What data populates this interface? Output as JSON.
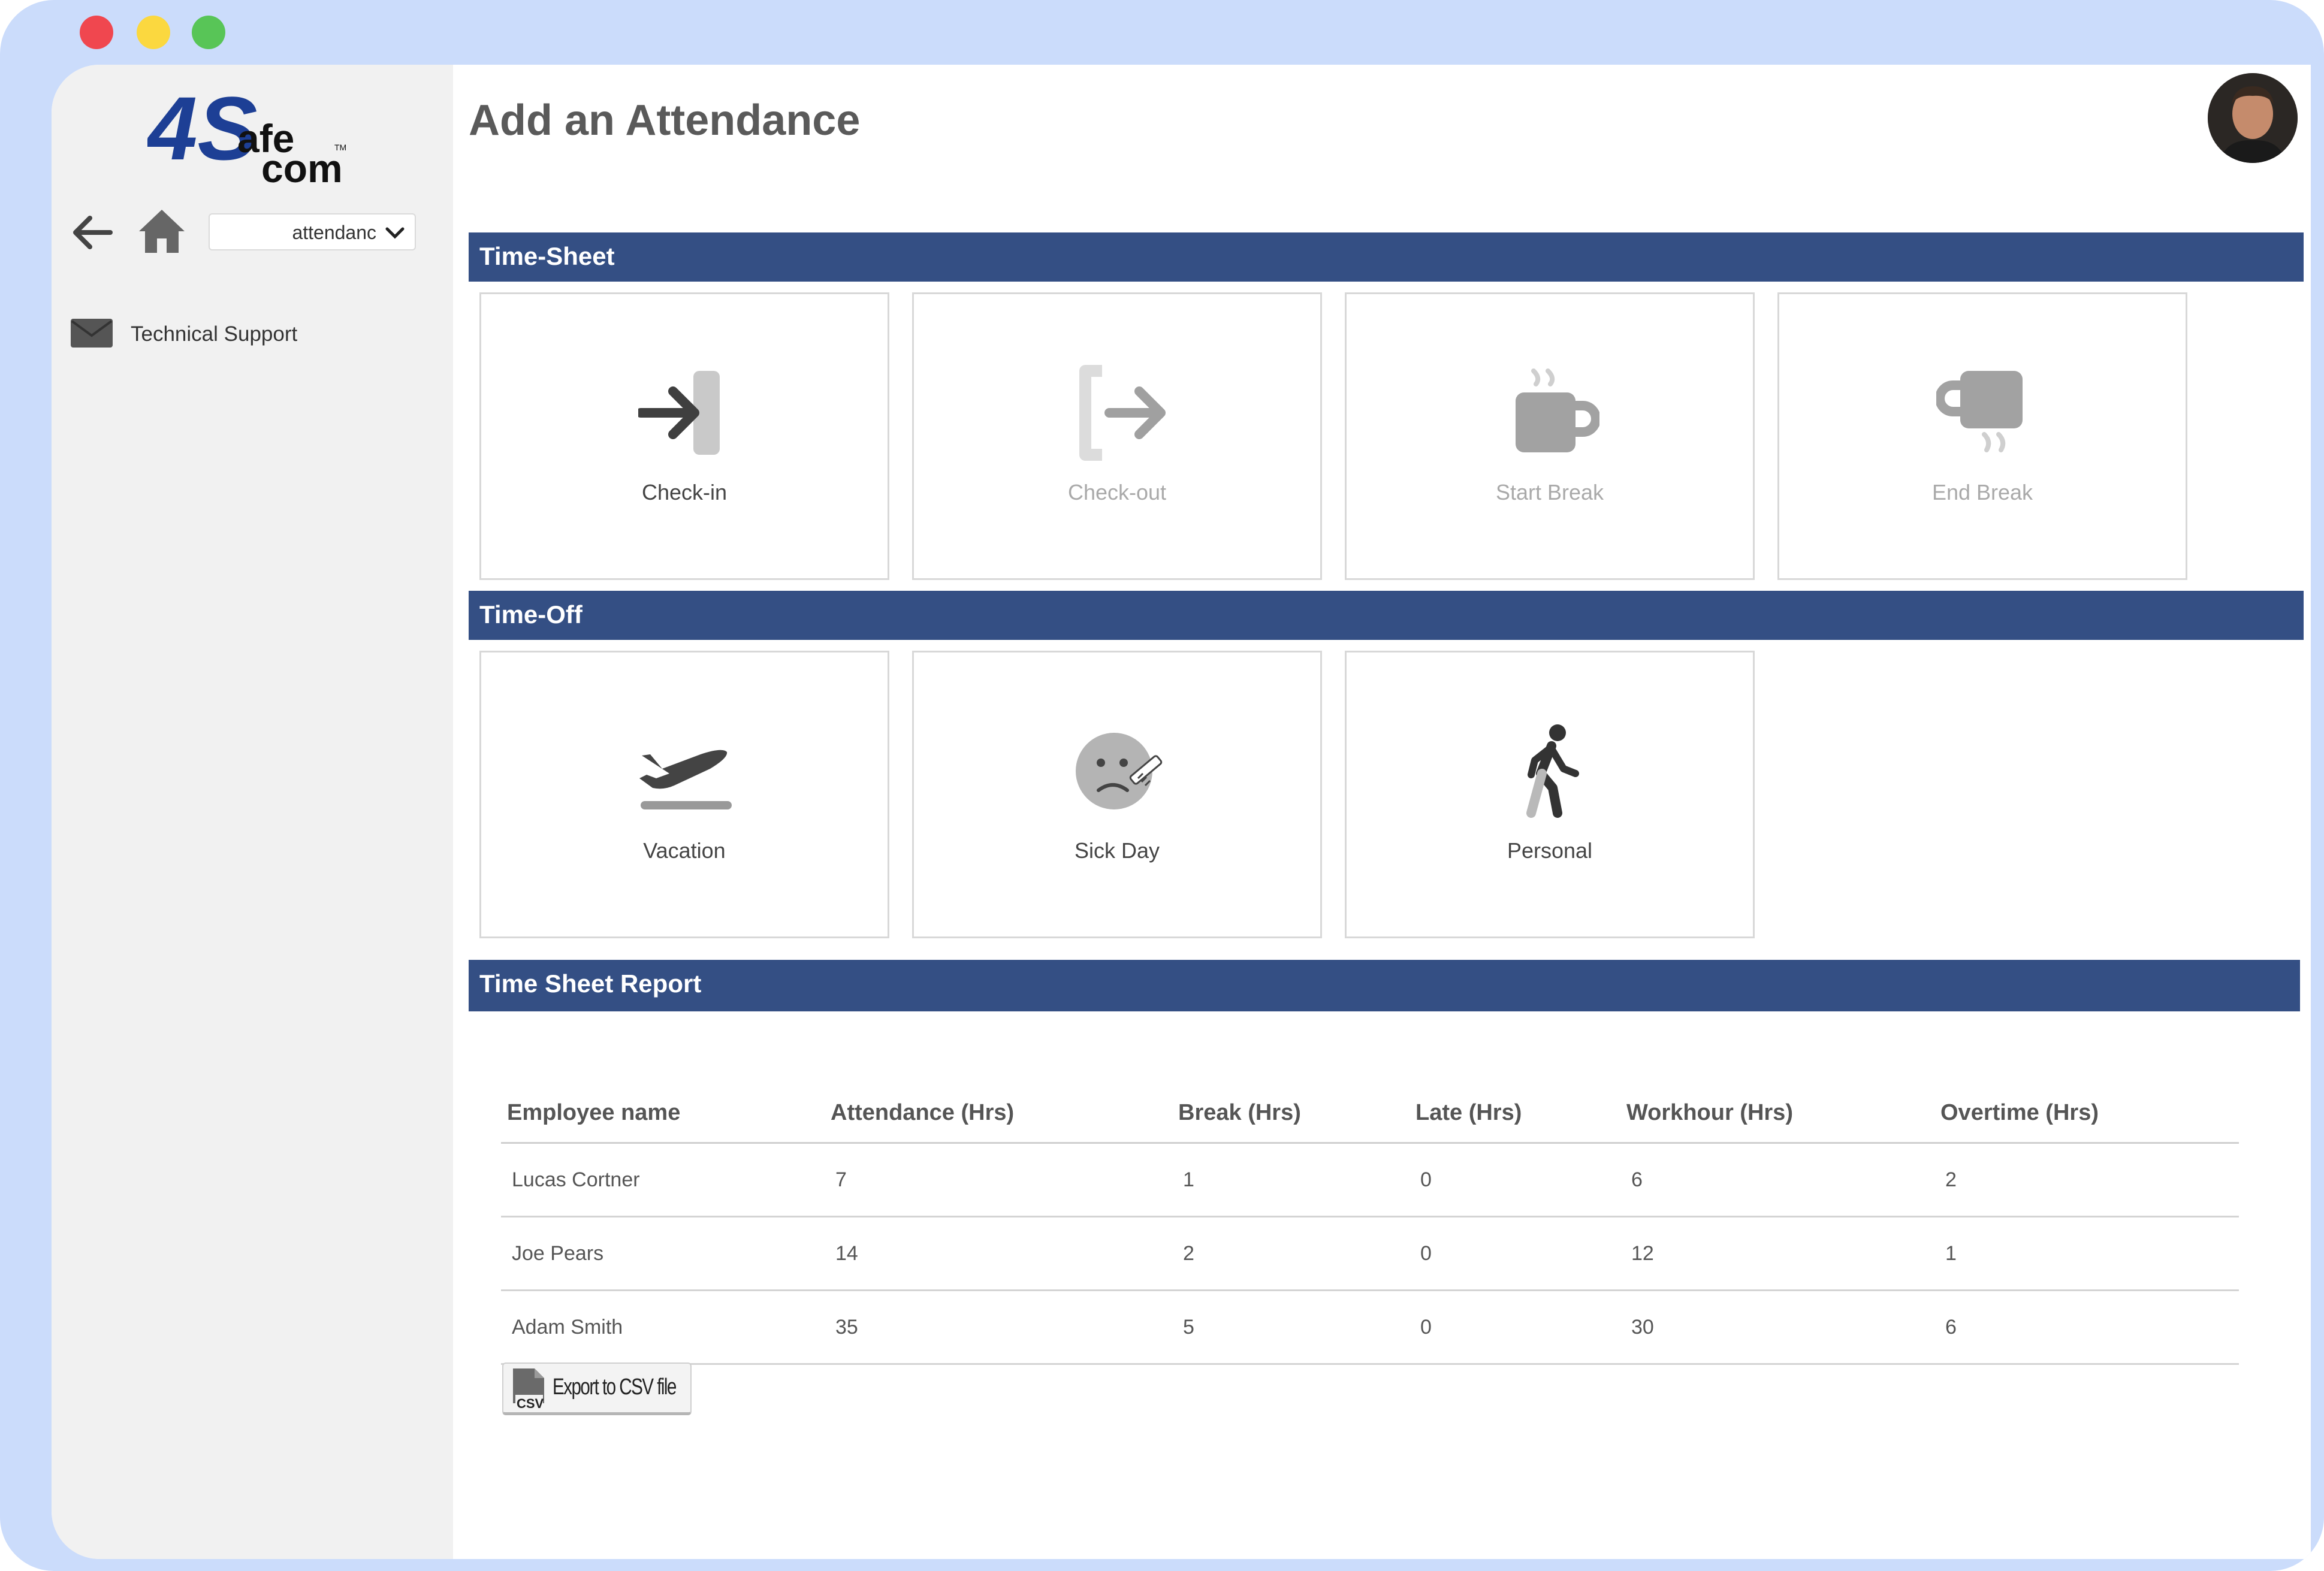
{
  "window": {
    "controls": [
      "close",
      "minimize",
      "maximize"
    ],
    "colors": {
      "frame": "#cbdcfb",
      "section_bar": "#344f84",
      "sidebar": "#f1f1f1"
    }
  },
  "sidebar": {
    "logo": {
      "main": "4S",
      "line1": "afe",
      "line2": "com",
      "tm": "TM"
    },
    "page_select": {
      "value": "attendanc"
    },
    "items": [
      {
        "label": "Technical Support",
        "icon": "envelope-icon"
      }
    ]
  },
  "page": {
    "title": "Add an Attendance"
  },
  "timesheet": {
    "title": "Time-Sheet",
    "cards": [
      {
        "label": "Check-in",
        "icon": "check-in-icon",
        "enabled": true
      },
      {
        "label": "Check-out",
        "icon": "check-out-icon",
        "enabled": false
      },
      {
        "label": "Start Break",
        "icon": "coffee-cup-icon",
        "enabled": false
      },
      {
        "label": "End Break",
        "icon": "upside-down-cup-icon",
        "enabled": false
      }
    ]
  },
  "timeoff": {
    "title": "Time-Off",
    "cards": [
      {
        "label": "Vacation",
        "icon": "airplane-icon"
      },
      {
        "label": "Sick Day",
        "icon": "sick-face-icon"
      },
      {
        "label": "Personal",
        "icon": "walking-person-icon"
      }
    ]
  },
  "report": {
    "title": "Time Sheet Report",
    "columns": [
      "Employee name",
      "Attendance (Hrs)",
      "Break (Hrs)",
      "Late (Hrs)",
      "Workhour (Hrs)",
      "Overtime (Hrs)"
    ],
    "rows": [
      [
        "Lucas Cortner",
        "7",
        "1",
        "0",
        "6",
        "2"
      ],
      [
        "Joe Pears",
        "14",
        "2",
        "0",
        "12",
        "1"
      ],
      [
        "Adam Smith",
        "35",
        "5",
        "0",
        "30",
        "6"
      ]
    ],
    "export_label": "Export to CSV file",
    "export_badge": "CSV"
  }
}
